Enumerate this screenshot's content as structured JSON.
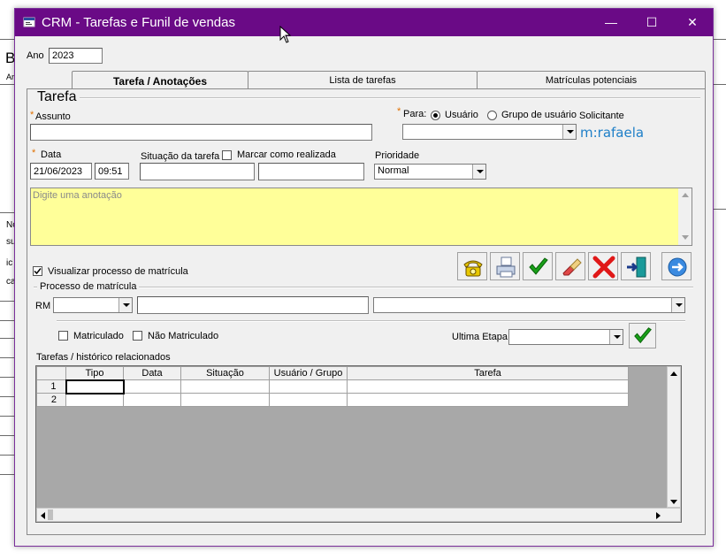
{
  "window": {
    "title": "CRM - Tarefas e Funil de vendas",
    "minimize_glyph": "—",
    "maximize_glyph": "☐",
    "close_glyph": "✕"
  },
  "background": {
    "letter_b": "B",
    "ar": "Ar",
    "no": "No",
    "su": "su",
    "ic": "ic",
    "ca": "ca"
  },
  "year": {
    "label": "Ano",
    "value": "2023"
  },
  "tabs": [
    {
      "label": "Tarefa / Anotações",
      "active": true
    },
    {
      "label": "Lista de tarefas",
      "active": false
    },
    {
      "label": "Matrículas potenciais",
      "active": false
    }
  ],
  "task": {
    "group_title": "Tarefa",
    "required_mark": "*",
    "assunto_label": "Assunto",
    "assunto_value": "",
    "para_label": "Para:",
    "radio_usuario": "Usuário",
    "radio_grupo": "Grupo de usuário",
    "para_selected": "Usuário",
    "para_value": "",
    "solicitante_label": "Solicitante",
    "solicitante_value": "m:rafaela",
    "data_label": "Data",
    "date_value": "21/06/2023",
    "time_value": "09:51",
    "situacao_label": "Situação da tarefa",
    "situacao_value": "",
    "situacao_value2": "",
    "marcar_label": "Marcar como realizada",
    "prioridade_label": "Prioridade",
    "prioridade_value": "Normal",
    "annotation_placeholder": "Digite uma anotação"
  },
  "visualizar_label": "Visualizar processo de matrícula",
  "visualizar_checked": true,
  "toolbar": {
    "phone": "phone-icon",
    "print": "printer-icon",
    "confirm": "check-icon",
    "clear": "eraser-icon",
    "cancel": "x-icon",
    "exit": "exit-door-icon",
    "next": "arrow-right-icon"
  },
  "processo": {
    "group_title": "Processo de matrícula",
    "rm_label": "RM",
    "rm_value": "",
    "name_value": "",
    "course_value": "",
    "matriculado_label": "Matriculado",
    "nao_matriculado_label": "Não Matriculado",
    "ultima_etapa_label": "Ultima Etapa",
    "ultima_etapa_value": ""
  },
  "history": {
    "title": "Tarefas / histórico relacionados",
    "columns": [
      "Tipo",
      "Data",
      "Situação",
      "Usuário / Grupo",
      "Tarefa"
    ],
    "rows": [
      {
        "num": "1",
        "cells": [
          "",
          "",
          "",
          "",
          ""
        ]
      },
      {
        "num": "2",
        "cells": [
          "",
          "",
          "",
          "",
          ""
        ]
      }
    ]
  },
  "colors": {
    "titlebar": "#6a0a86",
    "annotation_bg": "#ffff99",
    "solicitante": "#1e7fc8",
    "required": "#e07000"
  }
}
